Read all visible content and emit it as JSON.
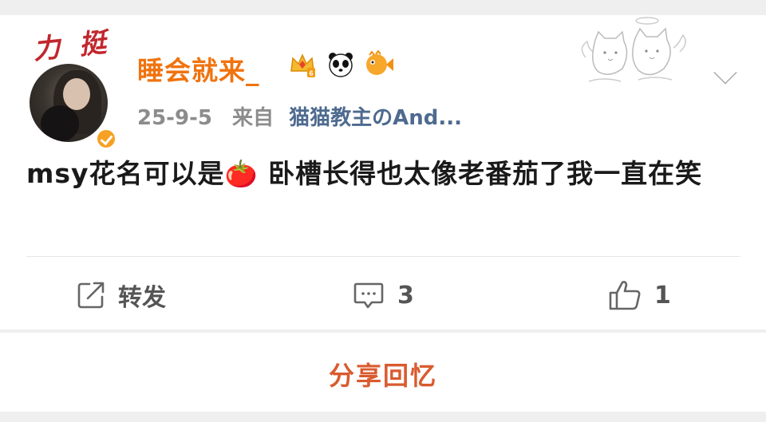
{
  "post": {
    "pendant_text": "力 挺",
    "username": "睡会就来_",
    "date": "25-9-5",
    "from_label": "来自",
    "source": "猫猫教主のAnd...",
    "text": "msy花名可以是🍅 卧槽长得也太像老番茄了我一直在笑"
  },
  "badges": [
    "crown-level-badge",
    "panda-badge",
    "fish-badge"
  ],
  "actions": {
    "repost_label": "转发",
    "comment_count": "3",
    "like_count": "1"
  },
  "footer": {
    "share_memory_label": "分享回忆"
  },
  "colors": {
    "username": "#f0730f",
    "source_link": "#4e6a8f",
    "share_memory": "#d95b2f",
    "verified": "#f7a124"
  }
}
